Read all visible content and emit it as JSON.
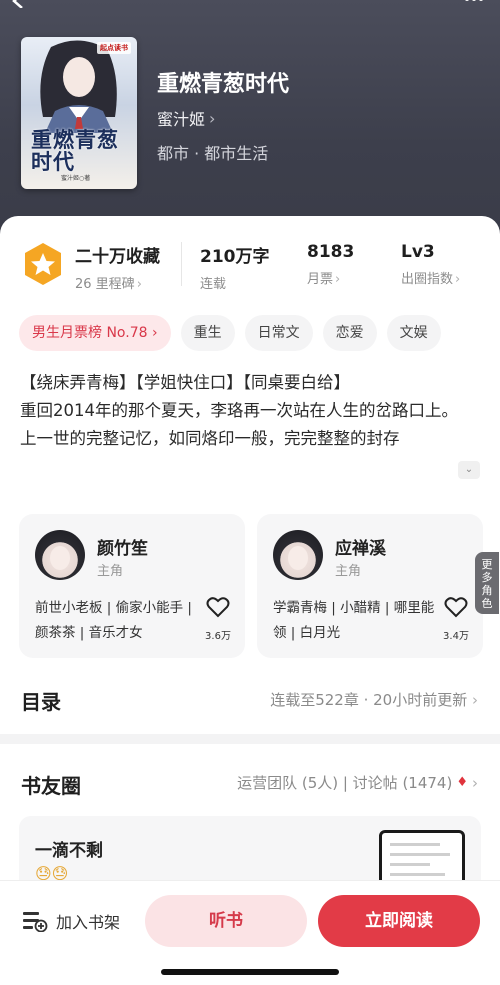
{
  "book": {
    "title": "重燃青葱时代",
    "author": "蜜汁姬",
    "genre": "都市 · 都市生活",
    "cover_title": "重燃青葱时代",
    "cover_brand": "起点读书",
    "cover_author": "蜜汁姬○著"
  },
  "stats": {
    "favorites": "二十万收藏",
    "milestone": "26 里程碑",
    "words": "210万字",
    "status": "连载",
    "monthly_votes": "8183",
    "monthly_votes_label": "月票",
    "level": "Lv3",
    "level_label": "出圈指数"
  },
  "tags": [
    "男生月票榜 No.78",
    "重生",
    "日常文",
    "恋爱",
    "文娱"
  ],
  "description": {
    "line1": "【绕床弄青梅】【学姐快住口】【同桌要白给】",
    "line2": "重回2014年的那个夏天，李珞再一次站在人生的岔路口上。",
    "line3": "上一世的完整记忆，如同烙印一般，完完整整的封存"
  },
  "characters": [
    {
      "name": "颜竹笙",
      "role": "主角",
      "desc": "前世小老板 | 偷家小能手 | 颜茶茶 | 音乐才女",
      "likes": "3.6万"
    },
    {
      "name": "应禅溪",
      "role": "主角",
      "desc": "学霸青梅 | 小醋精 | 哪里能领 | 白月光",
      "likes": "3.4万"
    }
  ],
  "more_roles": "更多角色",
  "catalog": {
    "title": "目录",
    "info": "连载至522章 · 20小时前更新"
  },
  "circle": {
    "title": "书友圈",
    "info": "运营团队 (5人) | 讨论帖 (1474)",
    "post_title": "一滴不剩",
    "post_emoji": "😓😓"
  },
  "bottom": {
    "shelf": "加入书架",
    "listen": "听书",
    "read": "立即阅读"
  },
  "colors": {
    "accent": "#e23b47",
    "accent_light": "#fbe3e5",
    "badge": "#f5a623"
  }
}
